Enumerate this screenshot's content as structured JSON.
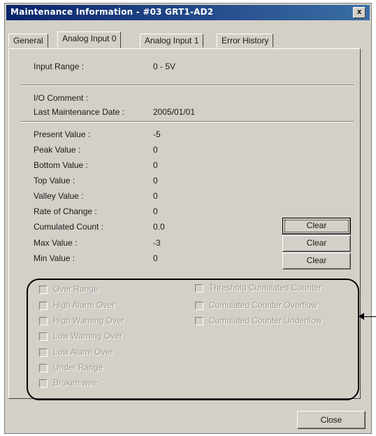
{
  "window": {
    "title": "Maintenance Information - #03 GRT1-AD2",
    "close_glyph": "x"
  },
  "tabs": [
    {
      "label": "General"
    },
    {
      "label": "Analog Input 0"
    },
    {
      "label": "Analog Input 1"
    },
    {
      "label": "Error History"
    }
  ],
  "input_range": {
    "label": "Input Range :",
    "value": "0 - 5V"
  },
  "io_comment": {
    "label": "I/O Comment :"
  },
  "last_maintenance": {
    "label": "Last Maintenance Date :",
    "value": "2005/01/01"
  },
  "values": [
    {
      "label": "Present Value :",
      "value": "-5"
    },
    {
      "label": "Peak Value :",
      "value": "0"
    },
    {
      "label": "Bottom Value :",
      "value": "0"
    },
    {
      "label": "Top Value :",
      "value": "0"
    },
    {
      "label": "Valley Value :",
      "value": "0"
    },
    {
      "label": "Rate of Change :",
      "value": "0"
    },
    {
      "label": "Cumulated Count :",
      "value": "0.0"
    },
    {
      "label": "Max Value :",
      "value": "-3"
    },
    {
      "label": "Min Value :",
      "value": "0"
    }
  ],
  "clear_buttons": [
    "Clear",
    "Clear",
    "Clear"
  ],
  "status_left": [
    "Over Range",
    "High Alarm Over",
    "High Warning Over",
    "Low Warning Over",
    "Low Alarm Over",
    "Under Range",
    "Broken wire"
  ],
  "status_right": [
    "Threshold Cumulated Counter",
    "Cumulated Counter Overflow",
    "Cumulated Counter Underflow"
  ],
  "close_button": "Close"
}
